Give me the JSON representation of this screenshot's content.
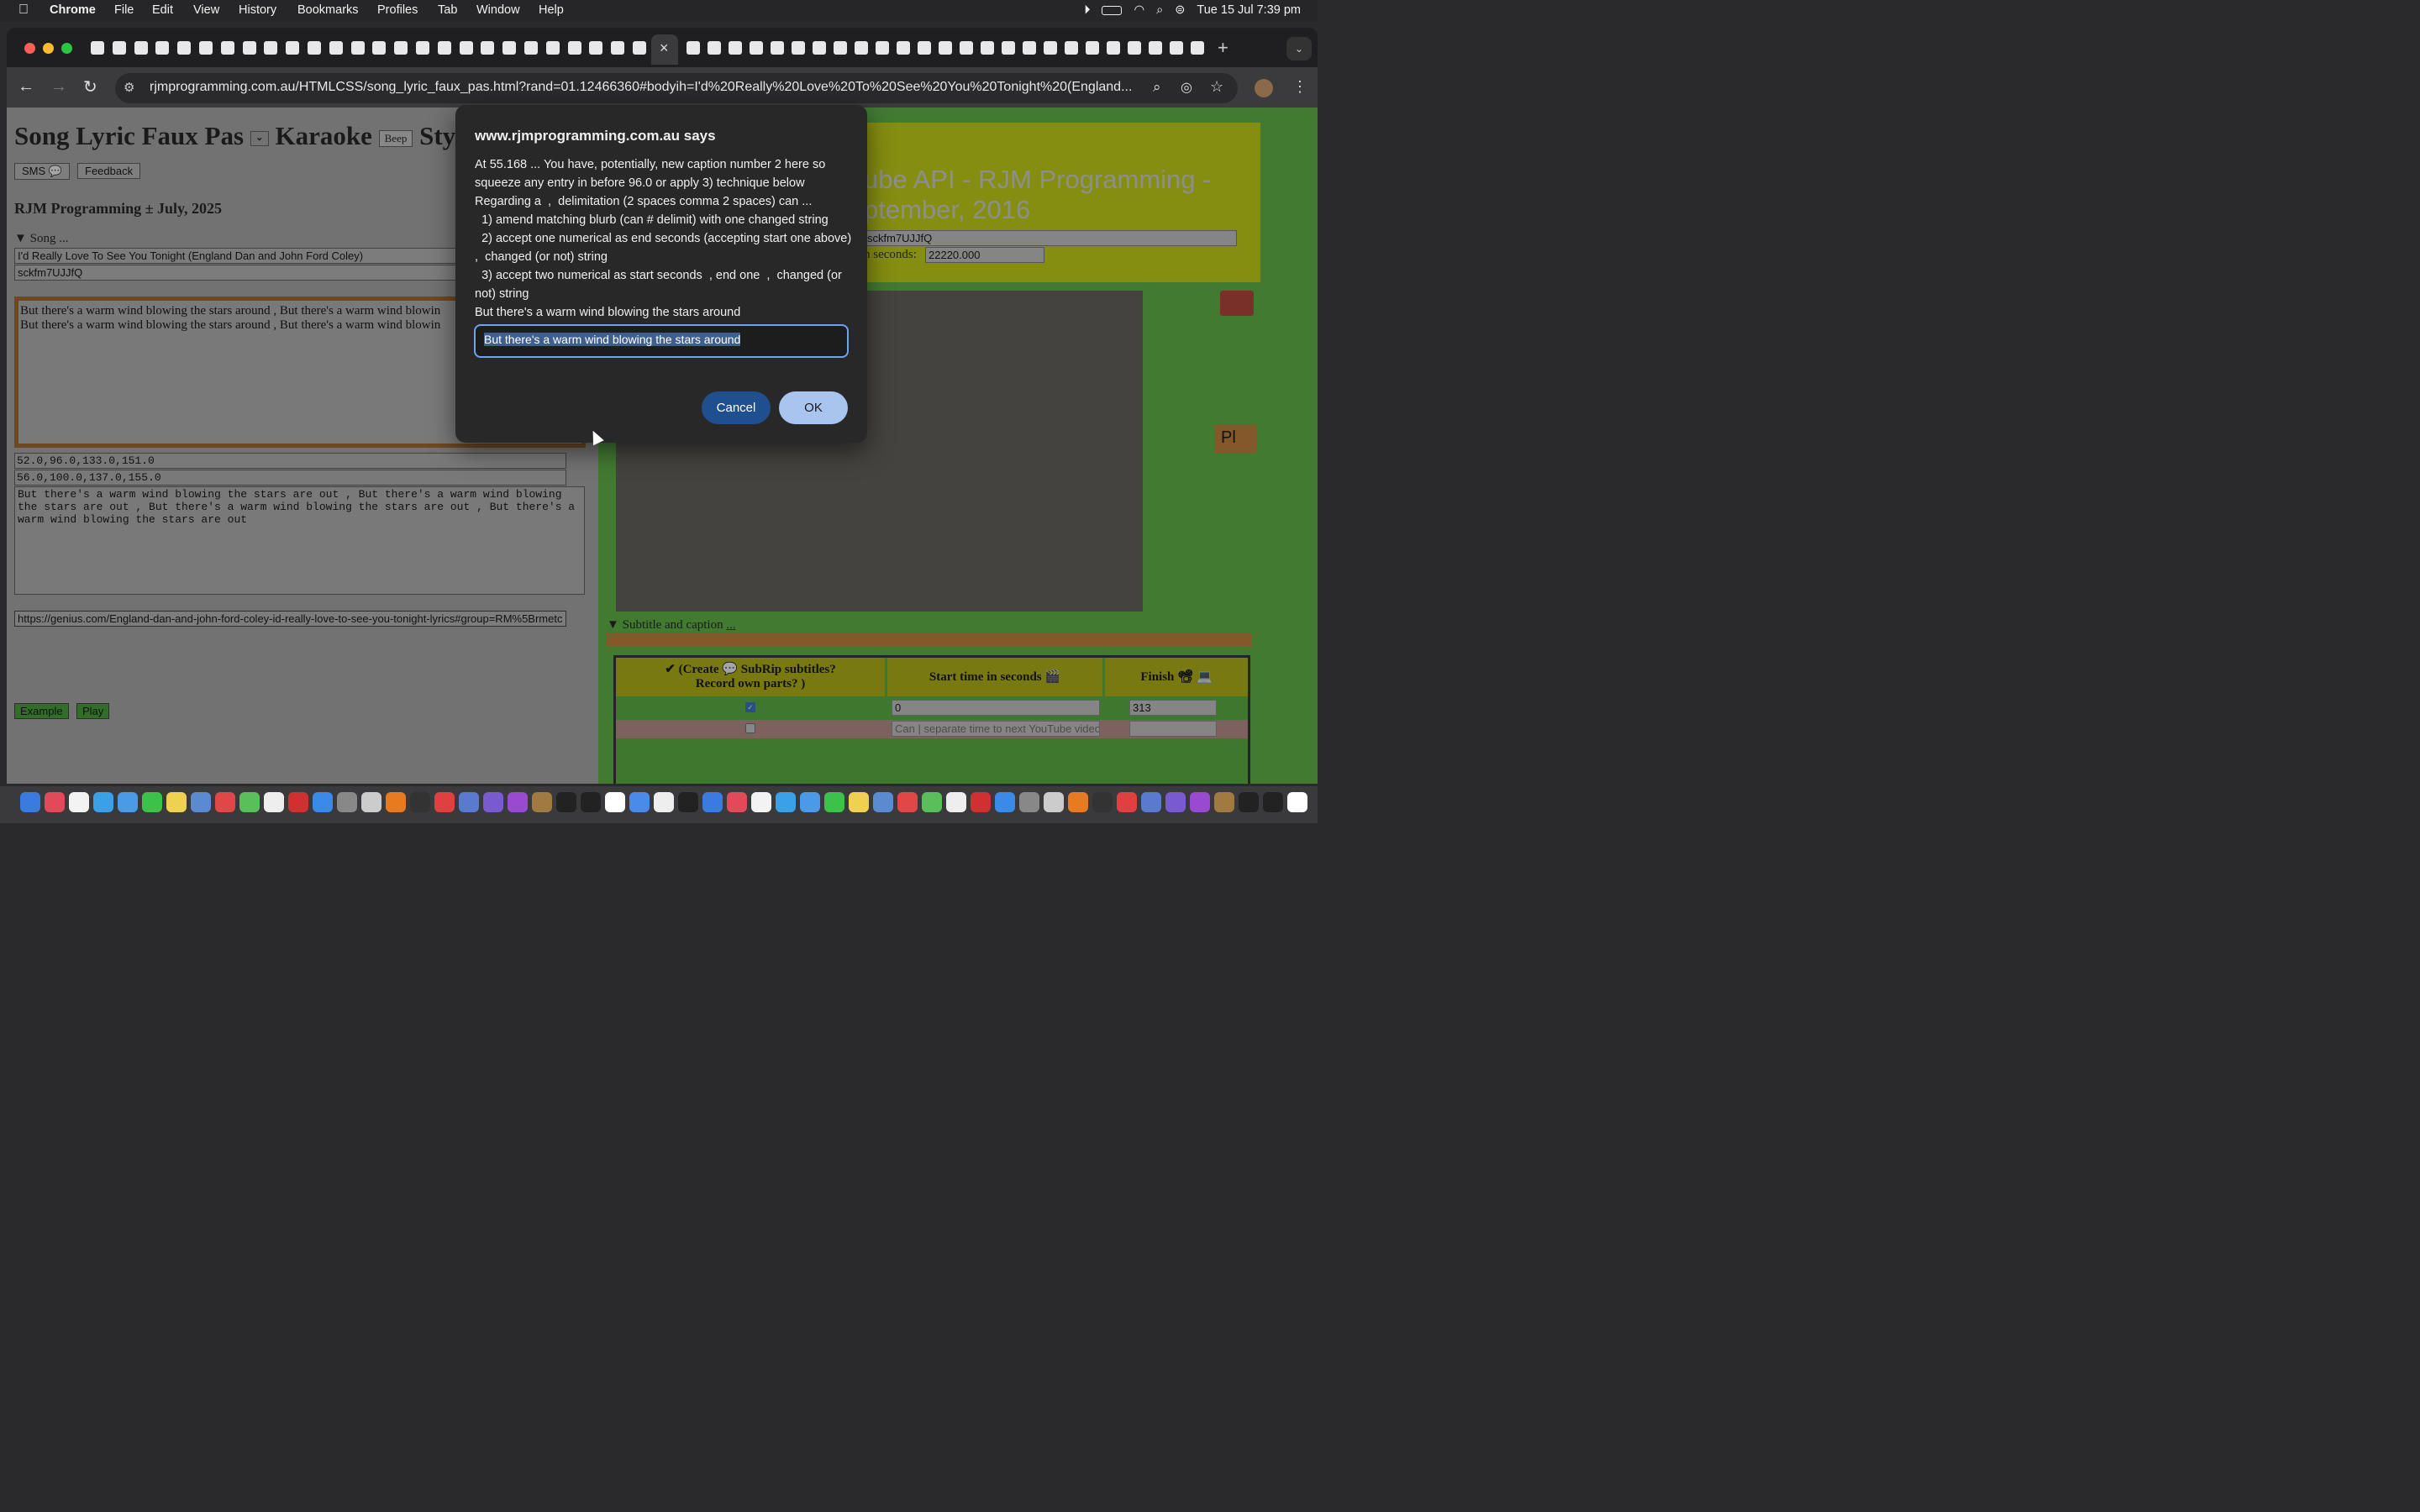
{
  "menubar": {
    "app": "Chrome",
    "items": [
      "File",
      "Edit",
      "View",
      "History",
      "Bookmarks",
      "Profiles",
      "Tab",
      "Window",
      "Help"
    ],
    "clock": "Tue 15 Jul  7:39 pm"
  },
  "tab": {
    "close": "×",
    "new": "+"
  },
  "address": {
    "url": "rjmprogramming.com.au/HTMLCSS/song_lyric_faux_pas.html?rand=01.12466360#bodyih=I'd%20Really%20Love%20To%20See%20You%20Tonight%20(England..."
  },
  "left": {
    "title": "Song Lyric Faux Pas",
    "karaoke": "Karaoke",
    "beep": "Beep",
    "sty": "Sty",
    "sms": "SMS 💬",
    "feedback": "Feedback",
    "author": "RJM Programming ± July, 2025",
    "song_summary": "▼ Song ...",
    "song_name": "I'd Really Love To See You Tonight (England Dan and John Ford Coley)",
    "video_id": "sckfm7UJJfQ",
    "lyrics": [
      "But there's a warm wind blowing the stars around , But there's a warm wind blowin",
      "But there's a warm wind blowing the stars around , But there's a warm wind blowin"
    ],
    "times_start": "52.0,96.0,133.0,151.0",
    "times_end": "56.0,100.0,137.0,155.0",
    "changed": "But there's a warm wind blowing the stars are out  ,  But there's a warm wind blowing the stars are out  ,  But there's a warm wind blowing the stars are out  ,  But there's a warm wind blowing the stars are out",
    "link": "https://genius.com/England-dan-and-john-ford-coley-id-really-love-to-see-you-tonight-lyrics#group=RM%5Brmetc",
    "example": "Example",
    "play": "Play"
  },
  "right": {
    "heading1": "ube API - RJM Programming -",
    "heading2": "ptember, 2016",
    "video_field": "sckfm7UJJfQ",
    "secs_label": "n seconds:",
    "secs_value": "22220.000",
    "subtitle_summary": "▼ Subtitle and caption",
    "subtitle_link": "...",
    "col1": "✔ (Create 💬 SubRip subtitles?",
    "col1b": "Record own parts?     )",
    "col2": "Start time in seconds 🎬",
    "col3": "Finish 📽 💻",
    "row1_start": "0",
    "row1_finish": "313",
    "row2_placeholder": "Can | separate time to next YouTube video",
    "side": "Pl"
  },
  "dialog": {
    "origin": "www.rjmprogramming.com.au says",
    "lines": [
      "At 55.168 ... You have, potentially, new caption number 2 here so squeeze any entry in before 96.0 or apply 3) technique below",
      "Regarding a  ,  delimitation (2 spaces comma 2 spaces) can ...",
      "  1) amend matching blurb (can # delimit) with one changed string",
      "  2) accept one numerical as end seconds (accepting start one above)  ,  changed (or not) string",
      "  3) accept two numerical as start seconds  , end one  ,  changed (or not) string",
      "But there's a warm wind blowing the stars around"
    ],
    "input_value": "But there's a warm wind blowing the stars around",
    "cancel": "Cancel",
    "ok": "OK"
  },
  "colors": {
    "accent": "#2b6cc4",
    "page_green": "#54d63d",
    "lime": "#c8e000",
    "orange": "#e88a2a"
  }
}
